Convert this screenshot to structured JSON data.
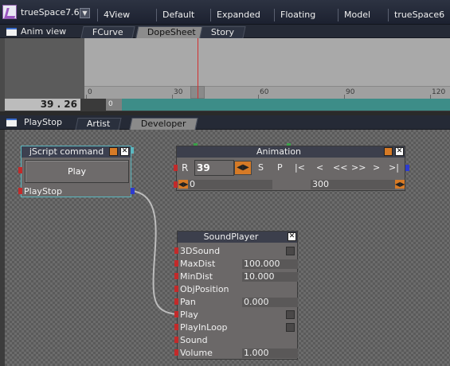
{
  "app": {
    "title": "trueSpace7.6"
  },
  "layouts": [
    "4View",
    "Default",
    "Expanded",
    "Floating",
    "Model",
    "trueSpace6"
  ],
  "anim_view": {
    "title": "Anim view",
    "tabs": [
      "FCurve",
      "DopeSheet",
      "Story"
    ],
    "active_tab": "DopeSheet",
    "ruler_labels": [
      "0",
      "30",
      "60",
      "90",
      "120"
    ],
    "current_frame": "39 . 26",
    "range_start": "0"
  },
  "playstop": {
    "title": "PlayStop",
    "tabs": [
      "Artist",
      "Developer"
    ],
    "active_tab": "Artist"
  },
  "jscript_node": {
    "title": "jScript command",
    "button_label": "Play",
    "port_label": "PlayStop"
  },
  "animation_node": {
    "title": "Animation",
    "r_label": "R",
    "frame_value": "39",
    "controls": [
      "S",
      "P",
      "|<",
      "<",
      "<<",
      ">>",
      ">",
      ">|"
    ],
    "range_from": "0",
    "range_to": "300"
  },
  "sound_node": {
    "title": "SoundPlayer",
    "rows": [
      {
        "label": "3DSound",
        "value": "",
        "type": "checkbox"
      },
      {
        "label": "MaxDist",
        "value": "100.000",
        "type": "field"
      },
      {
        "label": "MinDist",
        "value": "10.000",
        "type": "field"
      },
      {
        "label": "ObjPosition",
        "value": "",
        "type": "none"
      },
      {
        "label": "Pan",
        "value": "0.000",
        "type": "field"
      },
      {
        "label": "Play",
        "value": "",
        "type": "checkbox"
      },
      {
        "label": "PlayInLoop",
        "value": "",
        "type": "checkbox"
      },
      {
        "label": "Sound",
        "value": "",
        "type": "none"
      },
      {
        "label": "Volume",
        "value": "1.000",
        "type": "field"
      }
    ]
  },
  "colors": {
    "connector_in": "#c32a2a",
    "connector_out": "#2d3bd0",
    "range_bar": "#3d8d88",
    "cursor": "#d23030",
    "link": "#bcbcbc"
  }
}
